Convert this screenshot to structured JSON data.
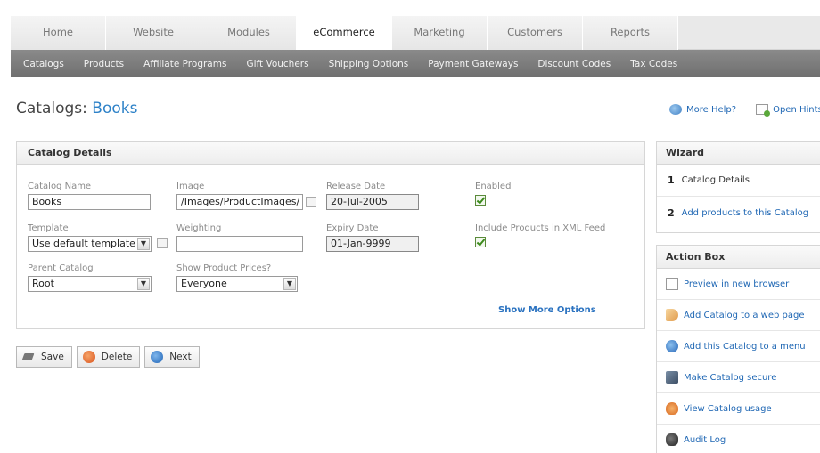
{
  "topnav": {
    "tabs": [
      {
        "label": "Home",
        "active": false
      },
      {
        "label": "Website",
        "active": false
      },
      {
        "label": "Modules",
        "active": false
      },
      {
        "label": "eCommerce",
        "active": true
      },
      {
        "label": "Marketing",
        "active": false
      },
      {
        "label": "Customers",
        "active": false
      },
      {
        "label": "Reports",
        "active": false
      }
    ]
  },
  "subnav": {
    "items": [
      "Catalogs",
      "Products",
      "Affiliate Programs",
      "Gift Vouchers",
      "Shipping Options",
      "Payment Gateways",
      "Discount Codes",
      "Tax Codes"
    ]
  },
  "page": {
    "title_prefix": "Catalogs:",
    "title_name": "Books",
    "more_help": "More Help?",
    "open_hints": "Open Hints"
  },
  "details": {
    "header": "Catalog Details",
    "catalog_name": {
      "label": "Catalog Name",
      "value": "Books"
    },
    "image": {
      "label": "Image",
      "value": "/Images/ProductImages/"
    },
    "release_date": {
      "label": "Release Date",
      "value": "20-Jul-2005"
    },
    "enabled": {
      "label": "Enabled",
      "checked": true
    },
    "template": {
      "label": "Template",
      "value": "Use default template"
    },
    "weighting": {
      "label": "Weighting",
      "value": ""
    },
    "expiry_date": {
      "label": "Expiry Date",
      "value": "01-Jan-9999"
    },
    "xml_feed": {
      "label": "Include Products in XML Feed",
      "checked": true
    },
    "parent_catalog": {
      "label": "Parent Catalog",
      "value": "Root"
    },
    "show_prices": {
      "label": "Show Product Prices?",
      "value": "Everyone"
    },
    "more_options": "Show More Options"
  },
  "buttons": {
    "save": "Save",
    "delete": "Delete",
    "next": "Next"
  },
  "wizard": {
    "header": "Wizard",
    "steps": [
      {
        "num": "1",
        "label": "Catalog Details"
      },
      {
        "num": "2",
        "label": "Add products to this Catalog"
      }
    ]
  },
  "action_box": {
    "header": "Action Box",
    "items": [
      {
        "label": "Preview in new browser",
        "icon": "browser-icon"
      },
      {
        "label": "Add Catalog to a web page",
        "icon": "tag-icon"
      },
      {
        "label": "Add this Catalog to a menu",
        "icon": "plus-icon"
      },
      {
        "label": "Make Catalog secure",
        "icon": "lock-icon"
      },
      {
        "label": "View Catalog usage",
        "icon": "eye-icon"
      },
      {
        "label": "Audit Log",
        "icon": "audit-icon"
      }
    ]
  }
}
